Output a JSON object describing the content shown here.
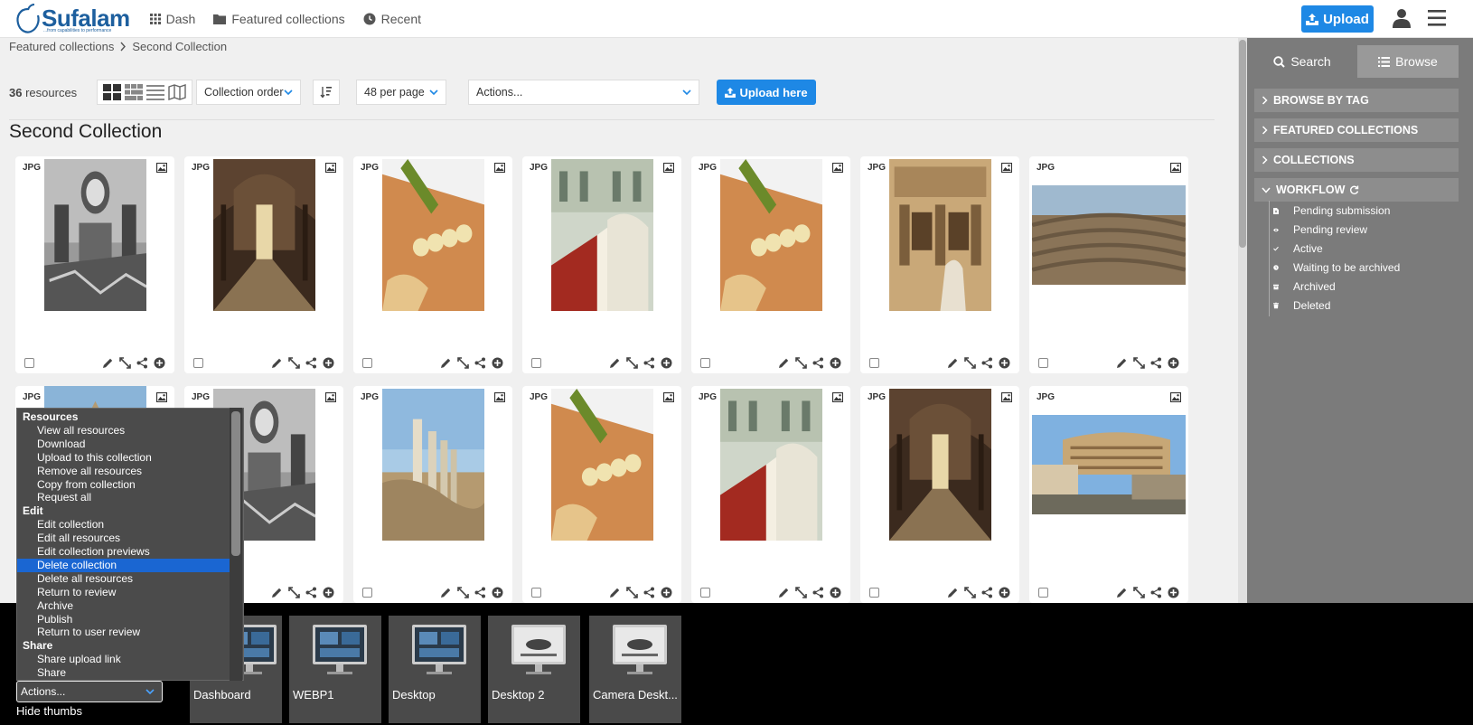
{
  "header": {
    "logo_text": "Sufalam",
    "logo_sub": "...from capabilities to performance",
    "nav": [
      {
        "label": "Dash",
        "icon": "grid-icon"
      },
      {
        "label": "Featured collections",
        "icon": "folder-icon"
      },
      {
        "label": "Recent",
        "icon": "clock-icon"
      }
    ],
    "upload_label": "Upload"
  },
  "breadcrumb": [
    "Featured collections",
    "Second Collection"
  ],
  "toolbar": {
    "count": "36",
    "count_suffix": "resources",
    "order_select": "Collection order",
    "per_page_select": "48 per page",
    "actions_select": "Actions...",
    "upload_here": "Upload here"
  },
  "collection_title": "Second Collection",
  "resources": [
    {
      "type": "JPG",
      "image": "cathedral-ruins-bw"
    },
    {
      "type": "JPG",
      "image": "cloister-corridor"
    },
    {
      "type": "JPG",
      "image": "bread-olive-oil"
    },
    {
      "type": "JPG",
      "image": "palace-staircase"
    },
    {
      "type": "JPG",
      "image": "bread-olive-oil"
    },
    {
      "type": "JPG",
      "image": "library-of-celsus"
    },
    {
      "type": "JPG",
      "image": "ancient-theatre"
    },
    {
      "type": "JPG",
      "image": "tower"
    },
    {
      "type": "JPG",
      "image": "cathedral-ruins-bw"
    },
    {
      "type": "JPG",
      "image": "ancient-columns"
    },
    {
      "type": "JPG",
      "image": "bread-olive-oil"
    },
    {
      "type": "JPG",
      "image": "palace-staircase"
    },
    {
      "type": "JPG",
      "image": "cloister-corridor"
    },
    {
      "type": "JPG",
      "image": "colosseum"
    }
  ],
  "sidebar": {
    "tabs": [
      "Search",
      "Browse"
    ],
    "sections": [
      "BROWSE BY TAG",
      "FEATURED COLLECTIONS",
      "COLLECTIONS",
      "WORKFLOW"
    ],
    "workflow_items": [
      {
        "label": "Pending submission",
        "icon": "file-upload-icon"
      },
      {
        "label": "Pending review",
        "icon": "eye-icon"
      },
      {
        "label": "Active",
        "icon": "check-icon"
      },
      {
        "label": "Waiting to be archived",
        "icon": "clock-icon"
      },
      {
        "label": "Archived",
        "icon": "archive-icon"
      },
      {
        "label": "Deleted",
        "icon": "trash-icon"
      }
    ]
  },
  "dropdown": [
    {
      "label": "Resources",
      "group": true
    },
    {
      "label": "View all resources"
    },
    {
      "label": "Download"
    },
    {
      "label": "Upload to this collection"
    },
    {
      "label": "Remove all resources"
    },
    {
      "label": "Copy from collection"
    },
    {
      "label": "Request all"
    },
    {
      "label": "Edit",
      "group": true
    },
    {
      "label": "Edit collection"
    },
    {
      "label": "Edit all resources"
    },
    {
      "label": "Edit collection previews"
    },
    {
      "label": "Delete collection",
      "selected": true
    },
    {
      "label": "Delete all resources"
    },
    {
      "label": "Return to review"
    },
    {
      "label": "Archive"
    },
    {
      "label": "Publish"
    },
    {
      "label": "Return to user review"
    },
    {
      "label": "Share",
      "group": true
    },
    {
      "label": "Share upload link"
    },
    {
      "label": "Share"
    }
  ],
  "bottom": {
    "actions_select": "Actions...",
    "hide_thumbs": "Hide thumbs",
    "collections": [
      "Dashboard",
      "WEBP1",
      "Desktop",
      "Desktop 2",
      "Camera Deskt..."
    ]
  },
  "colors": {
    "accent": "#1e88e5",
    "sidebar": "#7b7b7b",
    "selected": "#1a66d2"
  }
}
